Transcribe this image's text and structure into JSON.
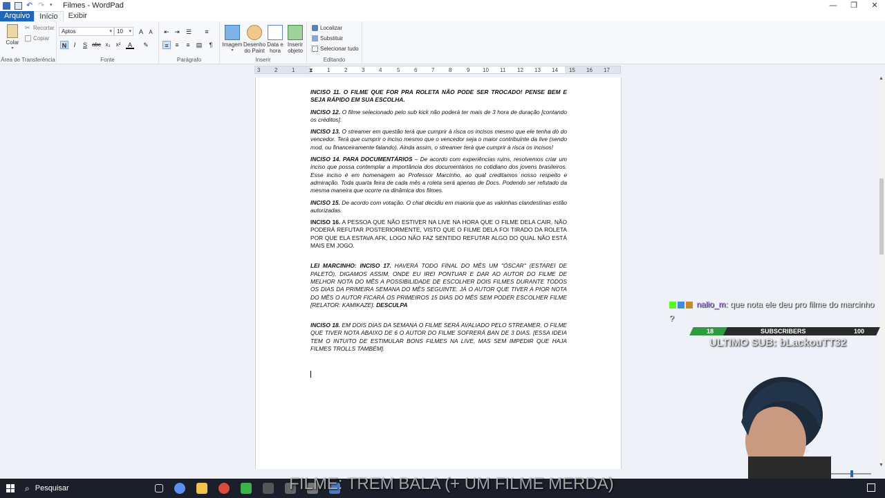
{
  "window": {
    "title": "Filmes - WordPad",
    "controls": [
      "—",
      "❐",
      "✕"
    ]
  },
  "tabs": [
    {
      "label": "Arquivo"
    },
    {
      "label": "Início"
    },
    {
      "label": "Exibir"
    }
  ],
  "ribbon": {
    "clipboard": {
      "paste_label": "Colar",
      "cut_label": "Recortar",
      "copy_label": "Copiar",
      "group_label": "Área de Transferência"
    },
    "font": {
      "font_name": "Aptos",
      "font_size": "10",
      "group_label": "Fonte"
    },
    "paragraph": {
      "group_label": "Parágrafo"
    },
    "insert": {
      "image_label": "Imagem",
      "paint_label_1": "Desenho",
      "paint_label_2": "do Paint",
      "datetime_label_1": "Data e",
      "datetime_label_2": "hora",
      "object_label_1": "Inserir",
      "object_label_2": "objeto",
      "group_label": "Inserir"
    },
    "editing": {
      "find_label": "Localizar",
      "replace_label": "Substituir",
      "select_all_label": "Selecionar tudo",
      "group_label": "Editando"
    }
  },
  "ruler": {
    "labels": [
      "3",
      "2",
      "1",
      "1",
      "2",
      "3",
      "4",
      "5",
      "6",
      "7",
      "8",
      "9",
      "10",
      "11",
      "12",
      "13",
      "14",
      "15",
      "16",
      "17"
    ]
  },
  "document": {
    "p1": {
      "bold": "INCISO 11. O FILME QUE FOR PRA ROLETA NÃO PODE SER TROCADO! PENSE BEM E SEJA RÁPIDO EM SUA ESCOLHA.",
      "text": ""
    },
    "p2": {
      "bold": "INCISO 12.",
      "text": " O filme selecionado pelo sub kick não poderá ter mais de 3 hora de duração [contando os créditos]."
    },
    "p3": {
      "bold": "INCISO 13.",
      "text": " O streamer em questão terá que cumprir à risca os incisos mesmo que ele tenha dò do vencedor. Terá que cumprir o inciso mesmo que o vencedor seja o maior contribuinte da live (sendo mod, ou financeiramente falando). Ainda assim, o streamer terá que cumprir à risca os incisos!"
    },
    "p4": {
      "bold": "INCISO 14. PARA DOCUMENTÁRIOS",
      "text": " – De acordo com experiências ruins, resolvemos criar um inciso que possa contemplar a importância dos documentários no cotidiano dos jovens brasileiros. Esse inciso é em homenagem ao Professor Marcinho, ao qual creditamos nosso respeito e admiração. Toda quarta feira de cada mês a roleta será apenas de Docs. Podendo ser refutado da mesma maneira que ocorre na dinâmica dos filmes."
    },
    "p5": {
      "bold": "INCISO 15.",
      "text": " De acordo com votação. O chat decidiu em maioria que as vakinhas clandestinas estão autorizadas."
    },
    "p6": {
      "bold": "INCISO 16.",
      "text": " A PESSOA QUE NÃO ESTIVER NA LIVE NA HORA QUE O FILME DELA CAIR, NÃO PODERÁ REFUTAR POSTERIORMENTE, VISTO QUE O FILME DELA FOI TIRADO DA ROLETA POR QUE ELA ESTAVA AFK, LOGO NÃO FAZ SENTIDO REFUTAR ALGO DO QUAL NÃO ESTÁ MAIS EM JOGO."
    },
    "p7": {
      "bold": "LEI MARCINHO: INCISO 17.",
      "text": " HAVERÁ TODO FINAL DO MÊS UM \"ÓSCAR\" (ESTAREI DE PALETÓ), DIGAMOS ASSIM, ONDE EU IREI PONTUAR E DAR AO AUTOR DO FILME DE MELHOR NOTA DO MÊS A POSSIBILIDADE DE ESCOLHER DOIS FILMES DURANTE TODOS OS DIAS DA PRIMEIRA SEMANA DO MÊS SEGUINTE. JÁ O AUTOR QUE TIVER A PIOR NOTA DO MÊS O AUTOR FICARÁ OS PRIMEIROS 15 DIAS DO MÊS SEM PODER ESCOLHER FILME [RELATOR: KAMIKAZE]. ",
      "tail": "DESCULPA"
    },
    "p8": {
      "bold": "INCISO 18.",
      "text": " EM DOIS DIAS DA SEMANA O FILME SERÁ AVALIADO PELO STREAMER. O FILME QUE TIVER NOTA ABAIXO DE 6 O AUTOR DO FILME SOFRERÁ BAN DE 3 DIAS. [ESSA IDEIA TEM O INTUITO DE ESTIMULAR BONS FILMES NA LIVE, MAS SEM IMPEDIR QUE HAJA FILMES TROLLS TAMBÉM]."
    }
  },
  "taskbar": {
    "search_label": "Pesquisar"
  },
  "overlay": {
    "chat_user": "nalio_m",
    "chat_message": ": que nota ele deu pro filme do marcinho ?",
    "subs_current": "18",
    "subs_label": "SUBSCRIBERS",
    "subs_goal": "100",
    "subs_progress": 0.18,
    "last_sub": "ULTIMO SUB: bLackouTT32",
    "film_banner": "FILME: TREM BALA (+ UM FILME MERDA)"
  },
  "colors": {
    "accent": "#1e66b8",
    "chat_user": "#b58cf0",
    "subs_fill": "#2e9b3e"
  }
}
